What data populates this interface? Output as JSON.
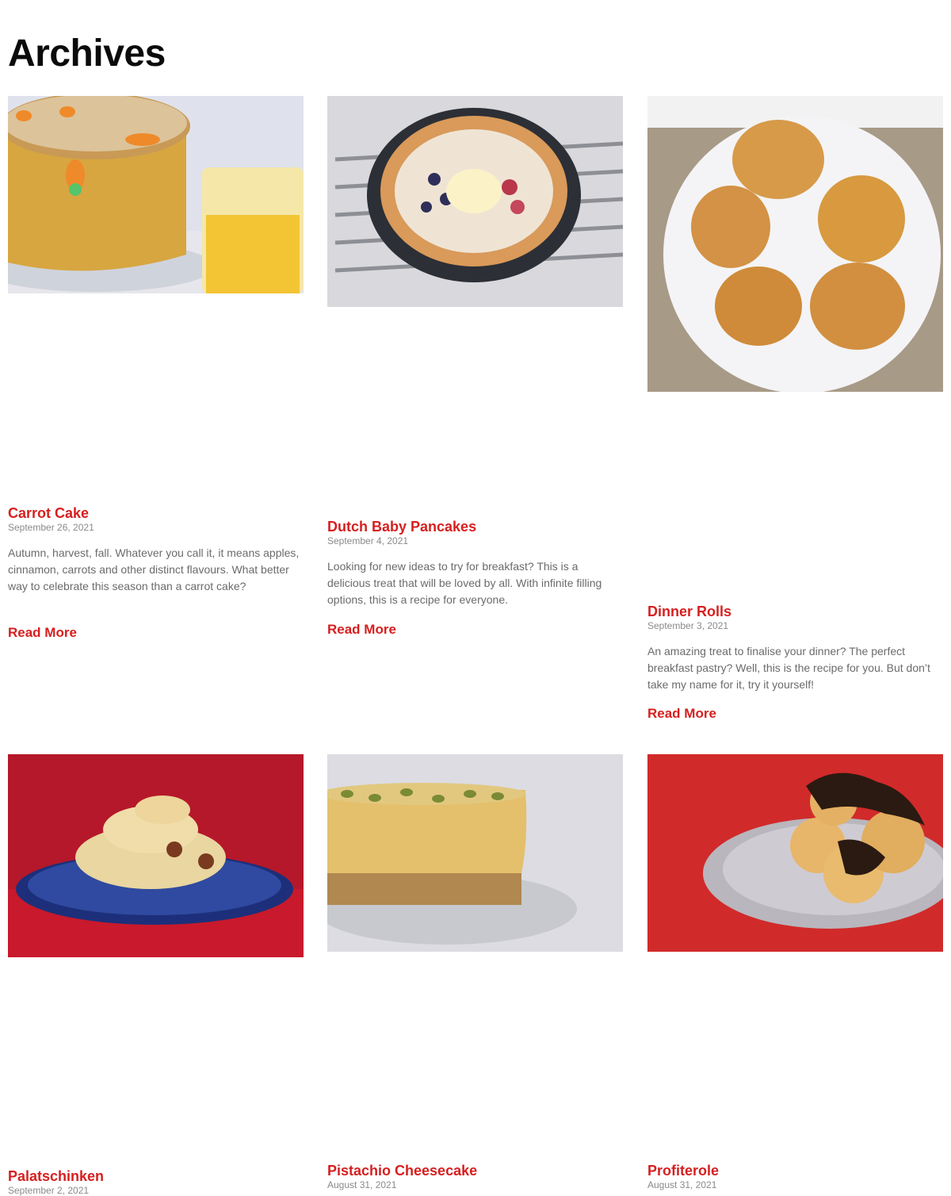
{
  "page": {
    "title": "Archives"
  },
  "posts": [
    {
      "title": "Carrot Cake",
      "date": "September 26, 2021",
      "excerpt": "Autumn, harvest, fall. Whatever you call it, it means apples, cinnamon, carrots and other distinct flavours. What better way to celebrate this season than a carrot cake?",
      "read_more": "Read More",
      "image": "carrot-cake-photo"
    },
    {
      "title": "Dutch Baby Pancakes",
      "date": "September 4, 2021",
      "excerpt": "Looking for new ideas to try for breakfast? This is a delicious treat that will be loved by all. With infinite filling options, this is a recipe for everyone.",
      "read_more": "Read More",
      "image": "dutch-baby-pancake-photo"
    },
    {
      "title": "Dinner Rolls",
      "date": "September 3, 2021",
      "excerpt": "An amazing treat to finalise your dinner? The perfect breakfast pastry? Well, this is the recipe for you. But don’t take my name for it, try it yourself!",
      "read_more": "Read More",
      "image": "dinner-rolls-photo"
    },
    {
      "title": "Palatschinken",
      "date": "September 2, 2021",
      "image": "palatschinken-photo"
    },
    {
      "title": "Pistachio Cheesecake",
      "date": "August 31, 2021",
      "image": "pistachio-cheesecake-photo"
    },
    {
      "title": "Profiterole",
      "date": "August 31, 2021",
      "image": "profiterole-photo"
    }
  ],
  "colors": {
    "accent": "#d61f1f",
    "meta": "#8a8a8a",
    "excerpt": "#6b6b6b"
  }
}
